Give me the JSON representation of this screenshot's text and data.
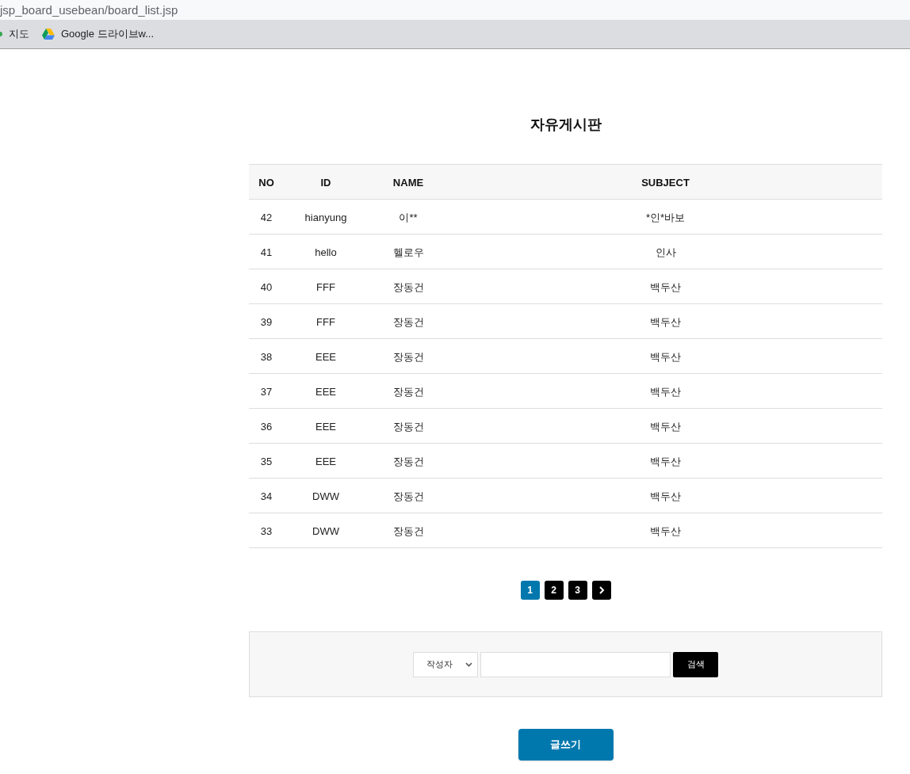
{
  "browser": {
    "url": "jsp_board_usebean/board_list.jsp",
    "bookmarks": [
      {
        "label": "지도",
        "kind": "dot"
      },
      {
        "label": "Google 드라이브w...",
        "kind": "drive"
      }
    ]
  },
  "title": "자유게시판",
  "table": {
    "columns": [
      "NO",
      "ID",
      "NAME",
      "SUBJECT"
    ],
    "rows": [
      [
        "42",
        "hianyung",
        "이**",
        "*인*바보"
      ],
      [
        "41",
        "hello",
        "헬로우",
        "인사"
      ],
      [
        "40",
        "FFF",
        "장동건",
        "백두산"
      ],
      [
        "39",
        "FFF",
        "장동건",
        "백두산"
      ],
      [
        "38",
        "EEE",
        "장동건",
        "백두산"
      ],
      [
        "37",
        "EEE",
        "장동건",
        "백두산"
      ],
      [
        "36",
        "EEE",
        "장동건",
        "백두산"
      ],
      [
        "35",
        "EEE",
        "장동건",
        "백두산"
      ],
      [
        "34",
        "DWW",
        "장동건",
        "백두산"
      ],
      [
        "33",
        "DWW",
        "장동건",
        "백두산"
      ]
    ]
  },
  "pagination": {
    "pages": [
      {
        "label": "1",
        "selected": true
      },
      {
        "label": "2",
        "selected": false
      },
      {
        "label": "3",
        "selected": false
      }
    ],
    "next": true
  },
  "search": {
    "field_select": "작성자",
    "button": "검색"
  },
  "write_button": "글쓰기"
}
